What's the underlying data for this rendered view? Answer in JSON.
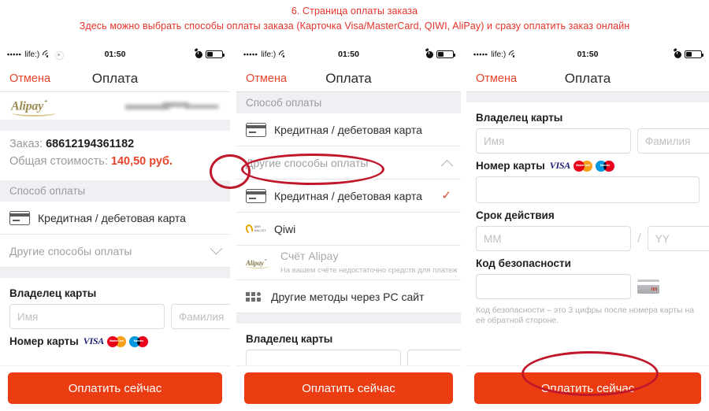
{
  "caption": {
    "line1": "6. Страница оплаты заказа",
    "line2": "Здесь можно выбрать способы оплаты заказа (Карточка Visa/MasterCard, QIWI, AliPay) и сразу оплатить заказ онлайн",
    "color": "#e8332a"
  },
  "status_bar": {
    "signal_dots": "•••••",
    "carrier": "life:)",
    "time": "01:50",
    "wifi_icon": "wifi-icon",
    "weather_icon": "sun-icon",
    "alarm_icon": "alarm-icon",
    "battery_icon": "battery-icon"
  },
  "nav": {
    "cancel": "Отмена",
    "title": "Оплата"
  },
  "panel1": {
    "brand_logo": "Alipay",
    "brand_sup": "⁺",
    "order_label": "Заказ:",
    "order_number": "68612194361182",
    "total_label": "Общая стоимость:",
    "total_value": "140,50 руб.",
    "section_payment_method": "Способ оплаты",
    "row_card": "Кредитная / дебетовая карта",
    "row_other": "Другие способы оплаты",
    "cardholder_label": "Владелец карты",
    "first_name_placeholder": "Имя",
    "last_name_placeholder": "Фамилия",
    "card_number_label": "Номер карты",
    "pay_button": "Оплатить сейчас"
  },
  "panel2": {
    "section_payment_method": "Способ оплаты",
    "row_card_top": "Кредитная / дебетовая карта",
    "row_other": "Другие способы оплаты",
    "options": [
      {
        "label": "Кредитная / дебетовая карта",
        "icon": "credit-card-icon",
        "selected": true,
        "check": "✓"
      },
      {
        "label": "Qiwi",
        "icon": "qiwi-icon",
        "selected": false
      },
      {
        "label": "Счёт Alipay",
        "icon": "alipay-icon",
        "selected": false,
        "desc": "На вашем счёте недостаточно средств для платеж"
      },
      {
        "label": "Другие методы через PC сайт",
        "icon": "grid-icon",
        "selected": false
      }
    ],
    "cardholder_label": "Владелец карты",
    "pay_button": "Оплатить сейчас"
  },
  "panel3": {
    "cardholder_label": "Владелец карты",
    "first_name_placeholder": "Имя",
    "last_name_placeholder": "Фамилия",
    "card_number_label": "Номер карты",
    "card_number_value": "",
    "expiry_label": "Срок действия",
    "expiry_month_placeholder": "MM",
    "expiry_year_placeholder": "YY",
    "expiry_separator": "/",
    "cvv_label": "Код безопасности",
    "cvv_value": "",
    "cvv_hint": "Код безопасности – это 3 цифры после номера карты на её обратной стороне.",
    "pay_button": "Оплатить сейчас"
  },
  "brands": {
    "visa": "VISA",
    "mastercard": "MasterCard",
    "maestro": "Maestro"
  },
  "qiwi_logo_text": "QIWI WALLET",
  "colors": {
    "accent_red": "#ec3c12",
    "cancel_red": "#e8442c",
    "annotation_red": "#c0172a",
    "section_grey": "#efeff4"
  }
}
